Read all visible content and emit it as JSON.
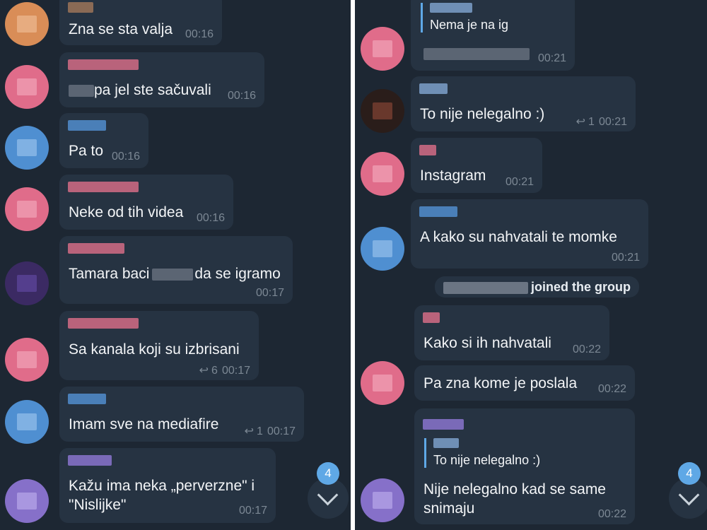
{
  "colors": {
    "background": "#1d2733",
    "bubble": "#263342",
    "text": "#f3f5f7",
    "meta": "#7c8894",
    "accent": "#5fa8e6",
    "sender_pink": "#e06c8a",
    "sender_blue": "#4f8fd1",
    "sender_purple": "#8670c9",
    "sender_orange": "#d98d57"
  },
  "left_chat": {
    "messages": [
      {
        "text": "Zna se sta valja",
        "time": "00:16"
      },
      {
        "text_after_blur": "pa jel ste sačuvali",
        "time": "00:16"
      },
      {
        "text": "Pa to",
        "time": "00:16"
      },
      {
        "text": "Neke od tih videa",
        "time": "00:16"
      },
      {
        "text_before_blur": "Tamara baci",
        "text_after_blur": "da se igramo",
        "time": "00:17"
      },
      {
        "text": "Sa kanala koji su izbrisani",
        "replies": "6",
        "time": "00:17"
      },
      {
        "text": "Imam sve na mediafire",
        "replies": "1",
        "time": "00:17"
      },
      {
        "text": "Kažu ima neka „perverzne\" i \"Nislijke\"",
        "time": "00:17"
      }
    ],
    "scroll_badge": "4"
  },
  "right_chat": {
    "messages": [
      {
        "quote_text": "Nema je na ig",
        "time": "00:21"
      },
      {
        "text": "To nije nelegalno :)",
        "replies": "1",
        "time": "00:21"
      },
      {
        "text": "Instagram",
        "time": "00:21"
      },
      {
        "text": "A kako su nahvatali te momke",
        "time": "00:21"
      },
      {
        "text": "Kako si ih nahvatali",
        "time": "00:22"
      },
      {
        "text": "Pa zna kome je poslala",
        "time": "00:22"
      },
      {
        "quote_text": "To nije nelegalno :)",
        "text": "Nije nelegalno kad se same snimaju",
        "time": "00:22"
      }
    ],
    "system": {
      "joined": "joined the group"
    },
    "scroll_badge": "4"
  },
  "icons": {
    "reply": "reply-arrow-icon",
    "scroll": "chevron-down-icon"
  }
}
